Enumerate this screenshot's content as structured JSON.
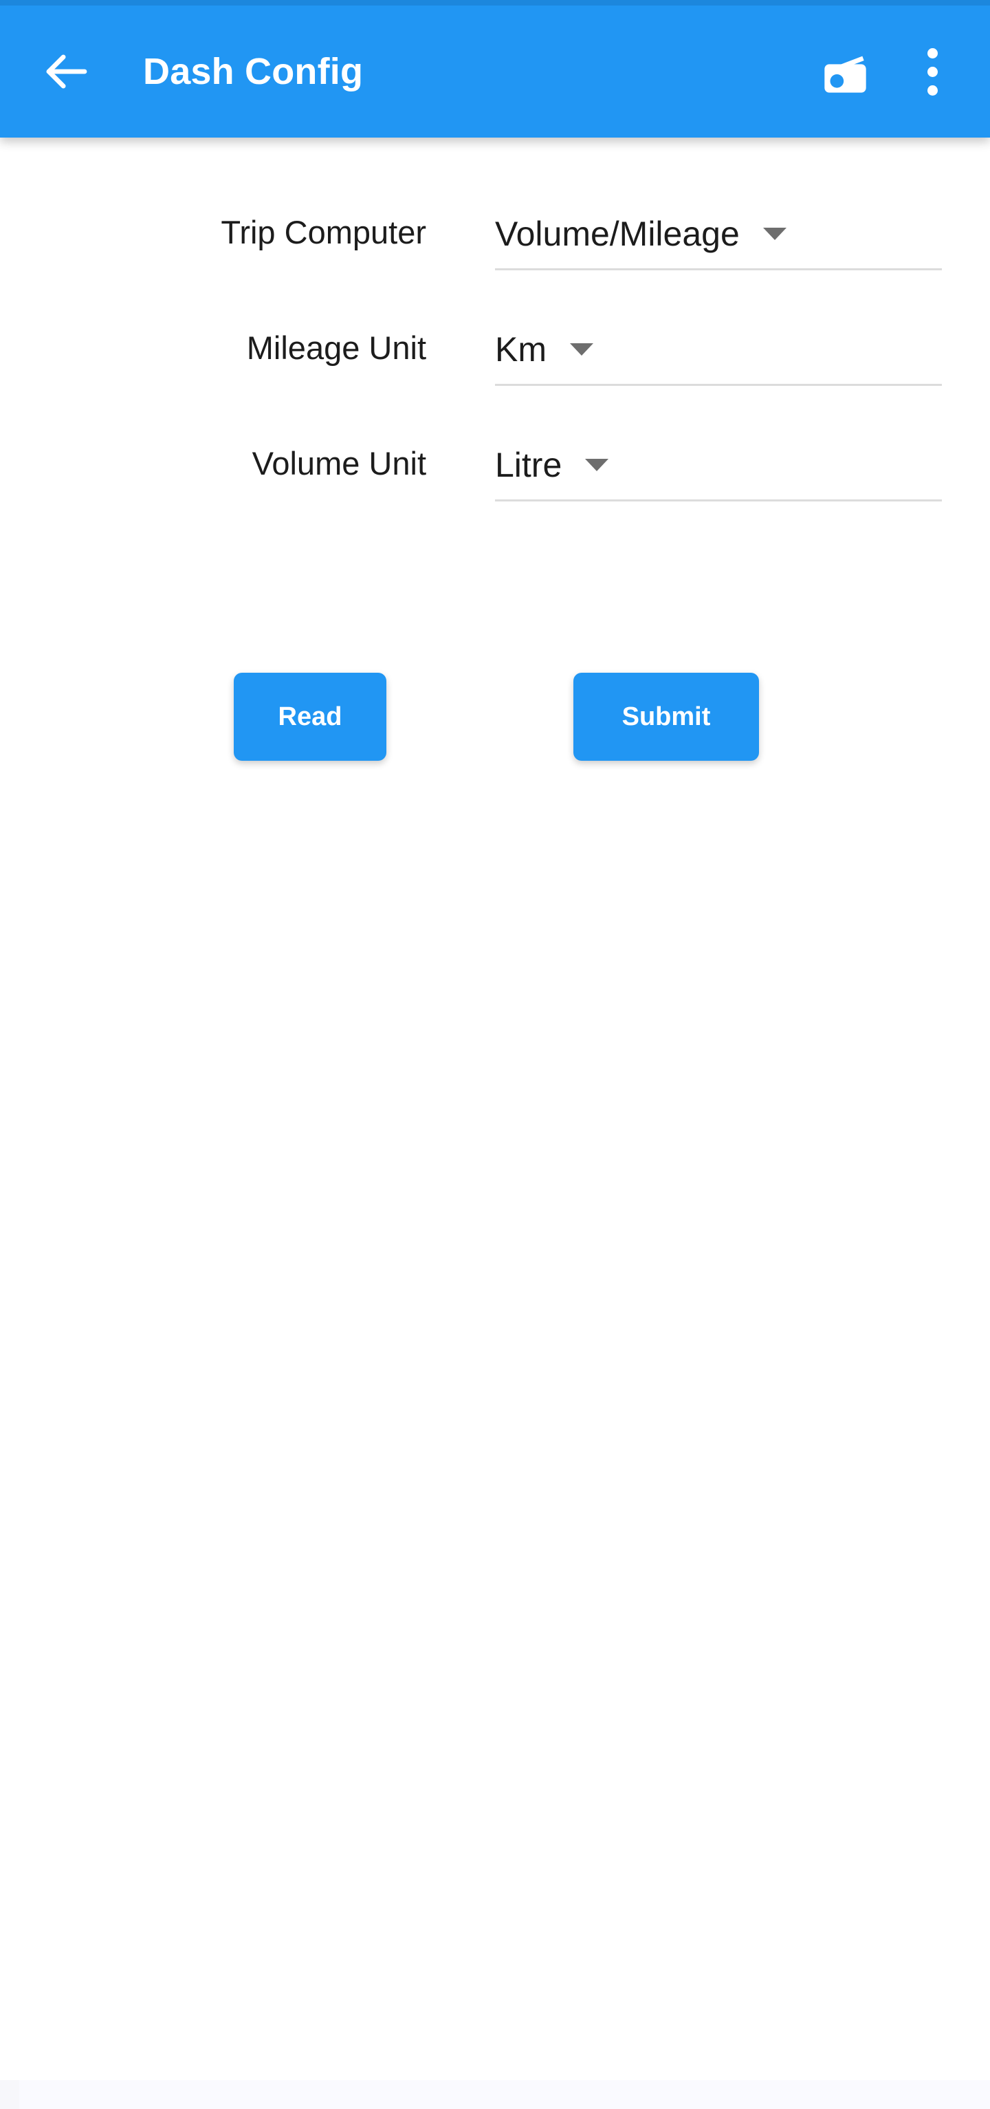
{
  "appbar": {
    "title": "Dash Config",
    "back_icon": "arrow-left-icon",
    "radio_icon": "radio-icon",
    "overflow_icon": "more-vert-icon",
    "background_color": "#2196f3",
    "text_color": "#ffffff"
  },
  "form": {
    "rows": [
      {
        "label": "Trip Computer",
        "value": "Volume/Mileage",
        "caret_icon": "chevron-down-icon"
      },
      {
        "label": "Mileage Unit",
        "value": "Km",
        "caret_icon": "chevron-down-icon"
      },
      {
        "label": "Volume Unit",
        "value": "Litre",
        "caret_icon": "chevron-down-icon"
      }
    ]
  },
  "actions": {
    "read_label": "Read",
    "submit_label": "Submit",
    "button_color": "#2196f3",
    "button_text_color": "#ffffff"
  }
}
